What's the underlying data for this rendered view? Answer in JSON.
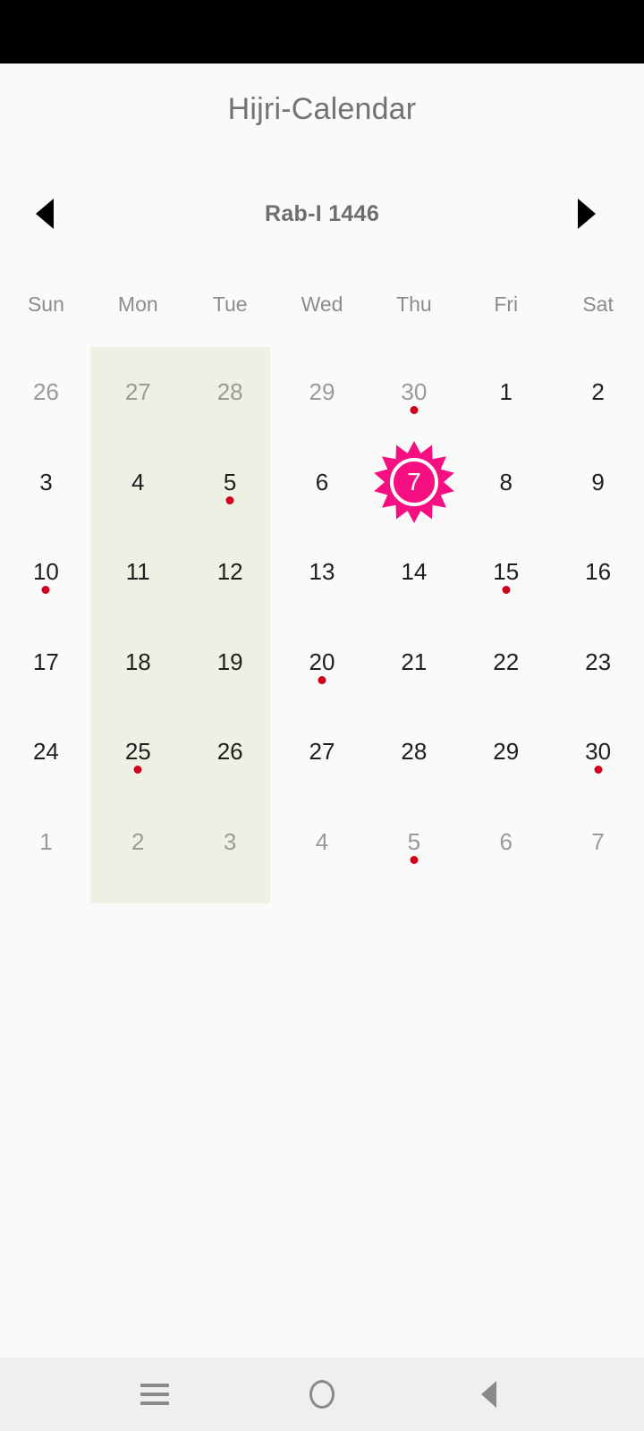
{
  "app": {
    "title": "Hijri-Calendar",
    "background_color": "#FAFAFA",
    "status_bar_color": "#000000"
  },
  "month_nav": {
    "prev_label": "◀",
    "prev_icon": "triangle-left-icon",
    "next_label": "▶",
    "next_icon": "triangle-right-icon",
    "current_month": "Rab-I 1446"
  },
  "weekdays": [
    "Sun",
    "Mon",
    "Tue",
    "Wed",
    "Thu",
    "Fri",
    "Sat"
  ],
  "colors": {
    "weekend_band": "#EDF1E4",
    "event_dot": "#D0021B",
    "selected_accent": "#F50F80",
    "day_text": "#1F1F1F",
    "muted_day_text": "#9A9A9A",
    "title_text": "#737373",
    "month_text": "#6E6E6E",
    "weekday_text": "#8C8C8C"
  },
  "calendar": {
    "selected_day": "7",
    "weeks": [
      [
        {
          "day": "26",
          "muted": true,
          "dot": false,
          "selected": false
        },
        {
          "day": "27",
          "muted": true,
          "dot": false,
          "selected": false
        },
        {
          "day": "28",
          "muted": true,
          "dot": false,
          "selected": false
        },
        {
          "day": "29",
          "muted": true,
          "dot": false,
          "selected": false
        },
        {
          "day": "30",
          "muted": true,
          "dot": true,
          "selected": false
        },
        {
          "day": "1",
          "muted": false,
          "dot": false,
          "selected": false
        },
        {
          "day": "2",
          "muted": false,
          "dot": false,
          "selected": false
        }
      ],
      [
        {
          "day": "3",
          "muted": false,
          "dot": false,
          "selected": false
        },
        {
          "day": "4",
          "muted": false,
          "dot": false,
          "selected": false
        },
        {
          "day": "5",
          "muted": false,
          "dot": true,
          "selected": false
        },
        {
          "day": "6",
          "muted": false,
          "dot": false,
          "selected": false
        },
        {
          "day": "7",
          "muted": false,
          "dot": false,
          "selected": true
        },
        {
          "day": "8",
          "muted": false,
          "dot": false,
          "selected": false
        },
        {
          "day": "9",
          "muted": false,
          "dot": false,
          "selected": false
        }
      ],
      [
        {
          "day": "10",
          "muted": false,
          "dot": true,
          "selected": false
        },
        {
          "day": "11",
          "muted": false,
          "dot": false,
          "selected": false
        },
        {
          "day": "12",
          "muted": false,
          "dot": false,
          "selected": false
        },
        {
          "day": "13",
          "muted": false,
          "dot": false,
          "selected": false
        },
        {
          "day": "14",
          "muted": false,
          "dot": false,
          "selected": false
        },
        {
          "day": "15",
          "muted": false,
          "dot": true,
          "selected": false
        },
        {
          "day": "16",
          "muted": false,
          "dot": false,
          "selected": false
        }
      ],
      [
        {
          "day": "17",
          "muted": false,
          "dot": false,
          "selected": false
        },
        {
          "day": "18",
          "muted": false,
          "dot": false,
          "selected": false
        },
        {
          "day": "19",
          "muted": false,
          "dot": false,
          "selected": false
        },
        {
          "day": "20",
          "muted": false,
          "dot": true,
          "selected": false
        },
        {
          "day": "21",
          "muted": false,
          "dot": false,
          "selected": false
        },
        {
          "day": "22",
          "muted": false,
          "dot": false,
          "selected": false
        },
        {
          "day": "23",
          "muted": false,
          "dot": false,
          "selected": false
        }
      ],
      [
        {
          "day": "24",
          "muted": false,
          "dot": false,
          "selected": false
        },
        {
          "day": "25",
          "muted": false,
          "dot": true,
          "selected": false
        },
        {
          "day": "26",
          "muted": false,
          "dot": false,
          "selected": false
        },
        {
          "day": "27",
          "muted": false,
          "dot": false,
          "selected": false
        },
        {
          "day": "28",
          "muted": false,
          "dot": false,
          "selected": false
        },
        {
          "day": "29",
          "muted": false,
          "dot": false,
          "selected": false
        },
        {
          "day": "30",
          "muted": false,
          "dot": true,
          "selected": false
        }
      ],
      [
        {
          "day": "1",
          "muted": true,
          "dot": false,
          "selected": false
        },
        {
          "day": "2",
          "muted": true,
          "dot": false,
          "selected": false
        },
        {
          "day": "3",
          "muted": true,
          "dot": false,
          "selected": false
        },
        {
          "day": "4",
          "muted": true,
          "dot": false,
          "selected": false
        },
        {
          "day": "5",
          "muted": true,
          "dot": true,
          "selected": false
        },
        {
          "day": "6",
          "muted": true,
          "dot": false,
          "selected": false
        },
        {
          "day": "7",
          "muted": true,
          "dot": false,
          "selected": false
        }
      ]
    ]
  },
  "system_nav": {
    "recents_icon": "hamburger-icon",
    "home_icon": "circle-icon",
    "back_icon": "triangle-back-icon"
  }
}
